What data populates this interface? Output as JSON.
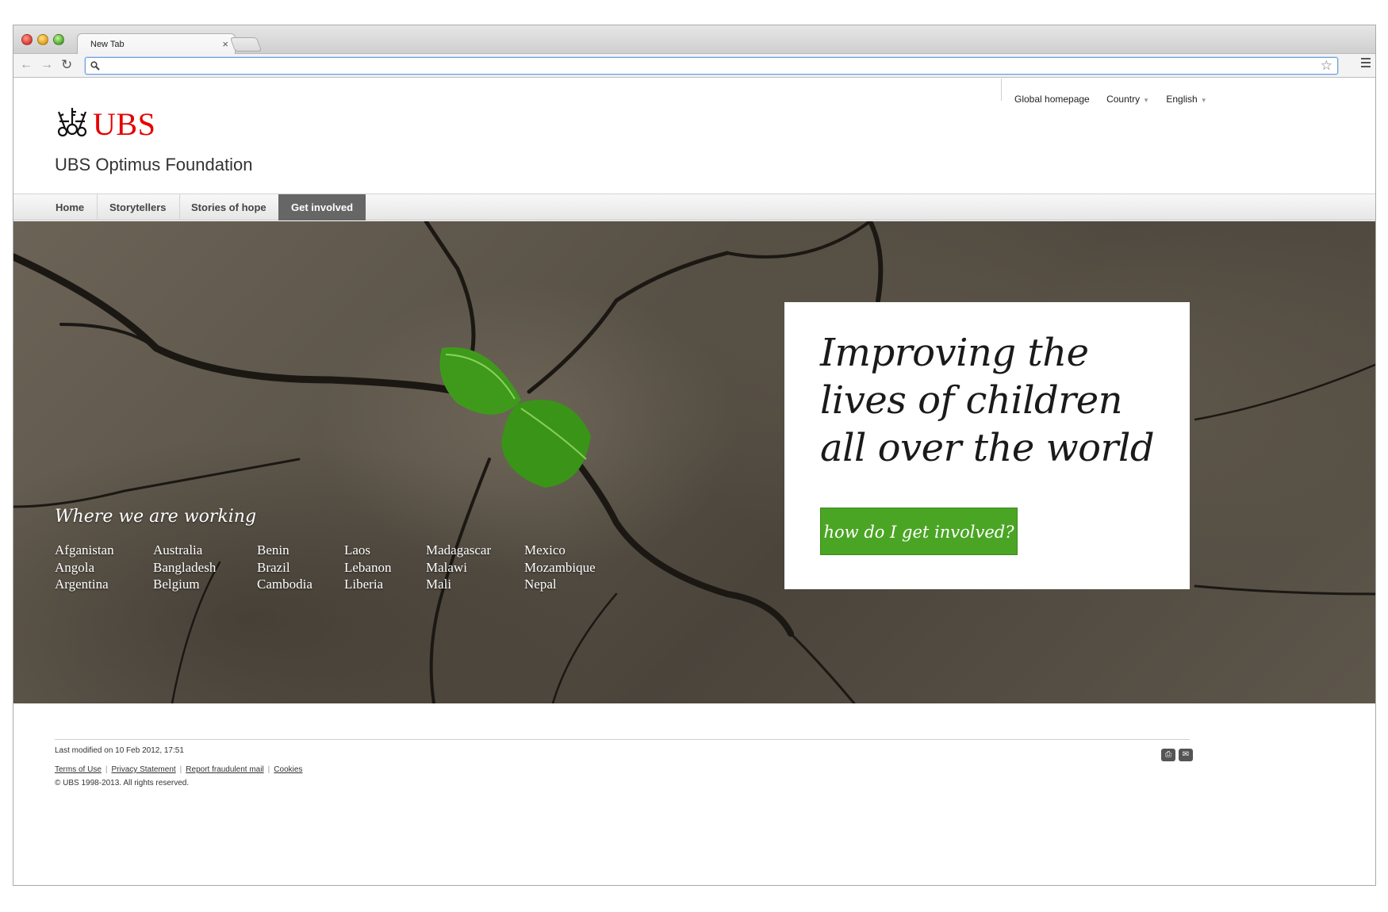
{
  "browser": {
    "tab_title": "New Tab",
    "tab_close": "×",
    "address_value": "",
    "star_icon": "☆",
    "search_icon": "⚲"
  },
  "header": {
    "logo_text": "UBS",
    "site_title": "UBS Optimus Foundation",
    "util_links": [
      "Global homepage",
      "Country",
      "English"
    ]
  },
  "mainnav": {
    "items": [
      "Home",
      "Storytellers",
      "Stories of hope",
      "Get involved"
    ],
    "active": "Get involved"
  },
  "hero": {
    "heading_lines": [
      "Improving the",
      "lives of children",
      "all over the world"
    ],
    "cta_label": "how do I get involved?",
    "where_title": "Where we are working",
    "countries": [
      [
        "Afganistan",
        "Angola",
        "Argentina"
      ],
      [
        "Australia",
        "Bangladesh",
        "Belgium"
      ],
      [
        "Benin",
        "Brazil",
        "Cambodia"
      ],
      [
        "Laos",
        "Lebanon",
        "Liberia"
      ],
      [
        "Madagascar",
        "Malawi",
        "Mali"
      ],
      [
        "Mexico",
        "Mozambique",
        "Nepal"
      ]
    ]
  },
  "footer": {
    "modified": "Last modified on 10 Feb 2012, 17:51",
    "links": [
      "Terms of Use",
      "Privacy Statement",
      "Report fraudulent mail",
      "Cookies"
    ],
    "copyright": "© UBS 1998-2013. All rights reserved.",
    "icons": [
      "print-icon",
      "email-icon"
    ]
  },
  "colors": {
    "brand_red": "#e60000",
    "cta_green": "#4aa524",
    "active_nav": "#666666"
  }
}
